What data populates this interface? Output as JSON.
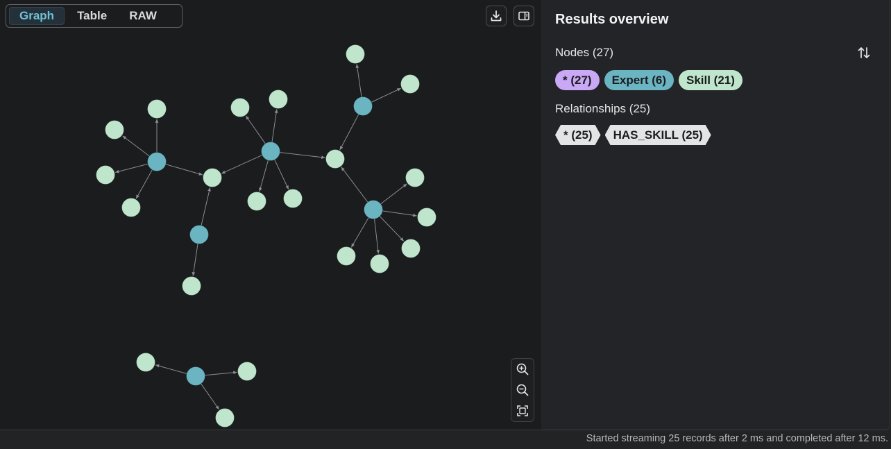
{
  "view_toggle": {
    "tabs": [
      {
        "label": "Graph",
        "active": true
      },
      {
        "label": "Table",
        "active": false
      },
      {
        "label": "RAW",
        "active": false
      }
    ]
  },
  "toolbar": {
    "download_icon": "download-icon",
    "panel_icon": "side-panel-icon"
  },
  "zoom": {
    "zoom_in_icon": "zoom-in-icon",
    "zoom_out_icon": "zoom-out-icon",
    "fit_icon": "fit-to-screen-icon"
  },
  "overview": {
    "title": "Results overview",
    "nodes_label": "Nodes (27)",
    "relationships_label": "Relationships (25)",
    "node_labels": [
      {
        "label": "* (27)",
        "color": "#c9a8f5"
      },
      {
        "label": "Expert (6)",
        "color": "#6bb4c2"
      },
      {
        "label": "Skill (21)",
        "color": "#bfe6cc"
      }
    ],
    "relationship_types": [
      {
        "label": "* (25)"
      },
      {
        "label": "HAS_SKILL (25)"
      }
    ]
  },
  "status": {
    "text": "Started streaming 25 records after 2 ms and completed after 12 ms."
  },
  "colors": {
    "expert": "#6bb4c2",
    "skill": "#bfe6cc",
    "edge": "#8a8d92"
  },
  "graph": {
    "experts": [
      "e1",
      "e2",
      "e3",
      "e4",
      "e5",
      "e6"
    ],
    "skills": [
      "s1",
      "s2",
      "s3",
      "s4",
      "s5",
      "s6",
      "s7",
      "s8",
      "s9",
      "s10",
      "s11",
      "s12",
      "s13",
      "s14",
      "s15",
      "s16",
      "s17",
      "s18",
      "s19",
      "s20",
      "s21"
    ],
    "relationships": [
      [
        "e1",
        "s1"
      ],
      [
        "e1",
        "s2"
      ],
      [
        "e1",
        "s3"
      ],
      [
        "e1",
        "s4"
      ],
      [
        "e1",
        "s5"
      ],
      [
        "e2",
        "s5"
      ],
      [
        "e2",
        "s6"
      ],
      [
        "e3",
        "s5"
      ],
      [
        "e3",
        "s7"
      ],
      [
        "e3",
        "s8"
      ],
      [
        "e3",
        "s9"
      ],
      [
        "e3",
        "s10"
      ],
      [
        "e3",
        "s11"
      ],
      [
        "e4",
        "s12"
      ],
      [
        "e4",
        "s13"
      ],
      [
        "e4",
        "s11"
      ],
      [
        "e5",
        "s11"
      ],
      [
        "e5",
        "s14"
      ],
      [
        "e5",
        "s15"
      ],
      [
        "e5",
        "s16"
      ],
      [
        "e5",
        "s17"
      ],
      [
        "e5",
        "s18"
      ],
      [
        "e6",
        "s19"
      ],
      [
        "e6",
        "s20"
      ],
      [
        "e6",
        "s21"
      ]
    ]
  }
}
